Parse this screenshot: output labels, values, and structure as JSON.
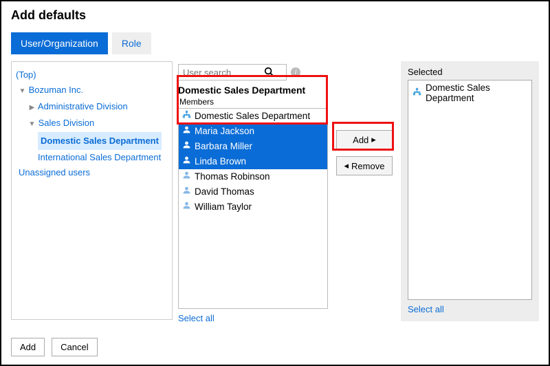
{
  "page_title": "Add defaults",
  "tabs": {
    "user_org": "User/Organization",
    "role": "Role"
  },
  "tree": {
    "top": "(Top)",
    "company": "Bozuman Inc.",
    "admin": "Administrative Division",
    "sales": "Sales Division",
    "domestic": "Domestic Sales Department",
    "international": "International Sales Department",
    "unassigned": "Unassigned users"
  },
  "search": {
    "placeholder": "User search"
  },
  "mid": {
    "heading": "Domestic Sales Department",
    "members_label": "Members",
    "select_all": "Select all"
  },
  "members": [
    {
      "kind": "org",
      "name": "Domestic Sales Department",
      "selected": false
    },
    {
      "kind": "person",
      "name": "Maria Jackson",
      "selected": true
    },
    {
      "kind": "person",
      "name": "Barbara Miller",
      "selected": true
    },
    {
      "kind": "person",
      "name": "Linda Brown",
      "selected": true
    },
    {
      "kind": "person",
      "name": "Thomas Robinson",
      "selected": false
    },
    {
      "kind": "person",
      "name": "David Thomas",
      "selected": false
    },
    {
      "kind": "person",
      "name": "William Taylor",
      "selected": false
    }
  ],
  "buttons": {
    "add": "Add",
    "remove": "Remove"
  },
  "selected_panel": {
    "title": "Selected",
    "items": [
      {
        "kind": "org",
        "name": "Domestic Sales Department"
      }
    ],
    "select_all": "Select all"
  },
  "footer": {
    "add": "Add",
    "cancel": "Cancel"
  }
}
